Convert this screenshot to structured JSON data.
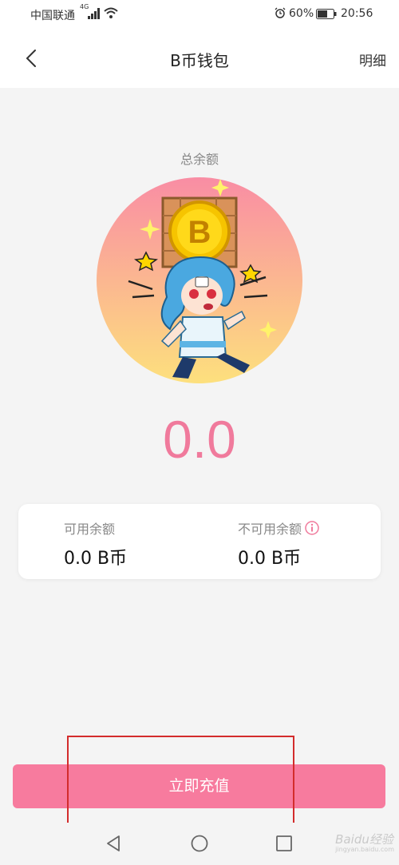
{
  "status_bar": {
    "carrier": "中国联通",
    "network": "4G",
    "battery": "60%",
    "time": "20:56"
  },
  "header": {
    "title": "B币钱包",
    "detail_label": "明细",
    "back_icon": "chevron-left-icon"
  },
  "wallet": {
    "total_label": "总余额",
    "total_value": "0.0",
    "hero_image": "coin-mascot-illustration",
    "available": {
      "label": "可用余额",
      "value": "0.0 B币"
    },
    "unavailable": {
      "label": "不可用余额",
      "value": "0.0 B币",
      "info_icon": "info-icon"
    }
  },
  "actions": {
    "recharge_label": "立即充值"
  },
  "colors": {
    "accent": "#f07a9c",
    "button": "#f77b9e",
    "highlight_box": "#d32c2c"
  },
  "watermark": {
    "text": "Baidu经验",
    "sub": "jingyan.baidu.com"
  }
}
